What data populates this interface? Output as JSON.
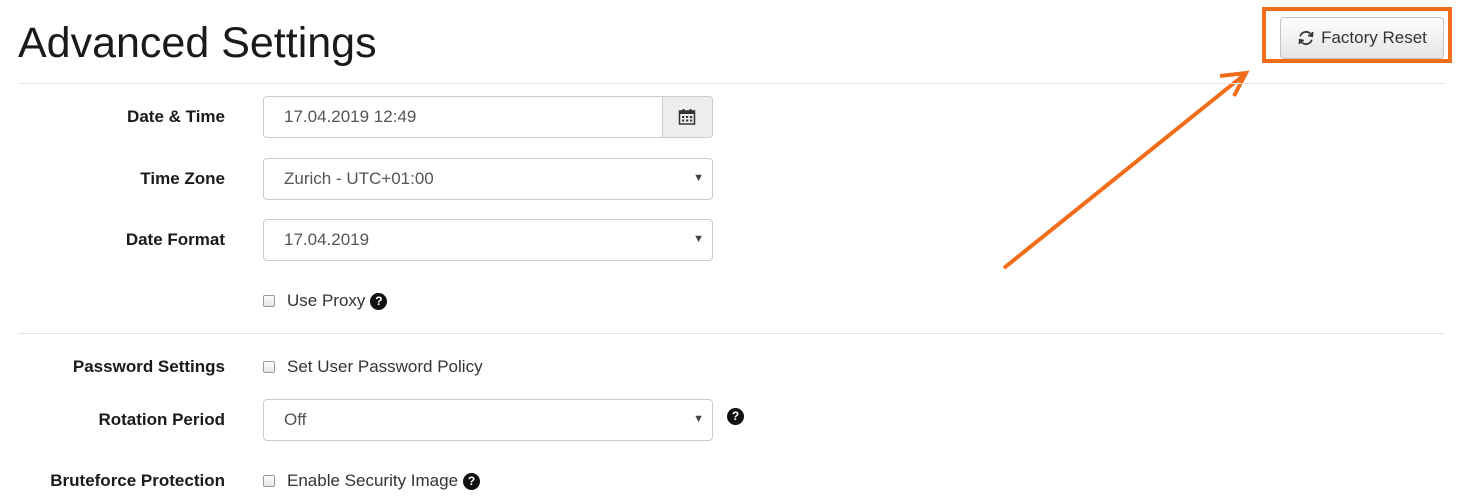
{
  "page": {
    "title": "Advanced Settings"
  },
  "toolbar": {
    "factory_reset_label": "Factory Reset",
    "factory_reset_icon": "refresh-icon"
  },
  "form": {
    "date_time": {
      "label": "Date & Time",
      "value": "17.04.2019 12:49",
      "icon": "calendar-icon"
    },
    "time_zone": {
      "label": "Time Zone",
      "value": "Zurich - UTC+01:00"
    },
    "date_format": {
      "label": "Date Format",
      "value": "17.04.2019"
    },
    "use_proxy": {
      "label": "Use Proxy",
      "checked": false,
      "icon": "help-icon"
    },
    "password_settings": {
      "label": "Password Settings",
      "checkbox_label": "Set User Password Policy",
      "checked": false
    },
    "rotation_period": {
      "label": "Rotation Period",
      "value": "Off",
      "icon": "help-icon"
    },
    "bruteforce": {
      "label": "Bruteforce Protection",
      "checkbox_label": "Enable Security Image",
      "checked": false,
      "icon": "help-icon"
    }
  },
  "colors": {
    "highlight": "#f26c1a",
    "text": "#333333",
    "border": "#cccccc",
    "addon_bg": "#eeeeee"
  }
}
